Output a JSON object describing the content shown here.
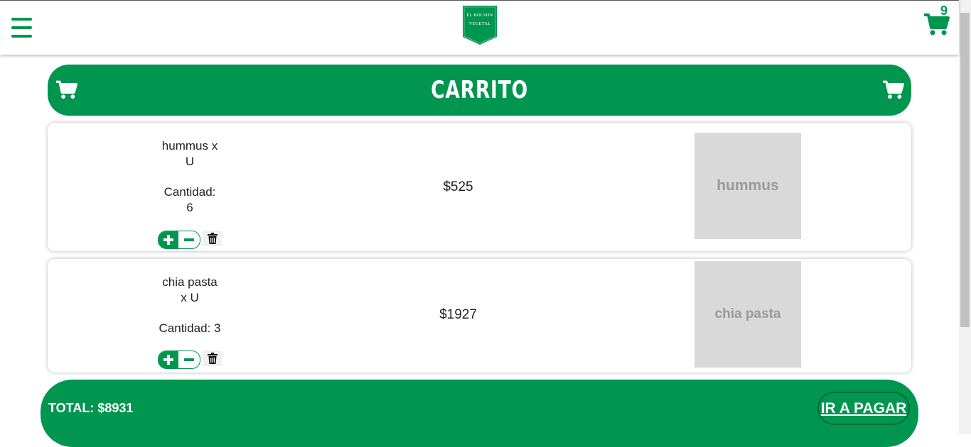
{
  "navbar": {
    "menu_icon": "hamburger-menu-icon",
    "logo": {
      "line1": "EL BOLSON",
      "line2": "VEGETAL"
    },
    "cart_icon": "shopping-cart-icon",
    "cart_count": "9"
  },
  "cart_header": {
    "title": "CARRITO",
    "left_icon": "shopping-cart-icon",
    "right_icon": "shopping-cart-icon"
  },
  "items": [
    {
      "name_line1": "hummus x",
      "name_line2": "U",
      "qty_line1": "Cantidad:",
      "qty_line2": "6",
      "price": "$525",
      "image_label": "hummus"
    },
    {
      "name_line1": "chia pasta",
      "name_line2": "x U",
      "qty_line1": "Cantidad: 3",
      "qty_line2": "",
      "price": "$1927",
      "image_label": "chia pasta"
    }
  ],
  "footer": {
    "total": "TOTAL: $8931",
    "pay_button": "IR A PAGAR"
  },
  "colors": {
    "brand_green": "#00964f",
    "placeholder_gray": "#d9d9d9"
  }
}
